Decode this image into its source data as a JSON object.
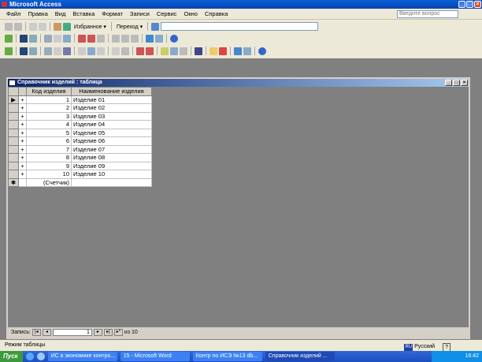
{
  "app": {
    "title": "Microsoft Access",
    "ask_placeholder": "Введите вопрос"
  },
  "menu": [
    "Файл",
    "Правка",
    "Вид",
    "Вставка",
    "Формат",
    "Записи",
    "Сервис",
    "Окно",
    "Справка"
  ],
  "web_toolbar": {
    "favorites": "Избранное ▾",
    "goto": "Переход ▾"
  },
  "child": {
    "title": "Справочник изделий : таблица",
    "columns": [
      "Код изделия",
      "Наименование изделия"
    ],
    "rows": [
      [
        "1",
        "Изделие 01"
      ],
      [
        "2",
        "Изделие 02"
      ],
      [
        "3",
        "Изделие 03"
      ],
      [
        "4",
        "Изделие 04"
      ],
      [
        "5",
        "Изделие 05"
      ],
      [
        "6",
        "Изделие 06"
      ],
      [
        "7",
        "Изделие 07"
      ],
      [
        "8",
        "Изделие 08"
      ],
      [
        "9",
        "Изделие 09"
      ],
      [
        "10",
        "Изделие 10"
      ]
    ],
    "new_row": "(Счетчик)",
    "nav": {
      "label": "Запись:",
      "current": "1",
      "of": "из 10"
    }
  },
  "status": {
    "mode": "Режим таблицы",
    "lang_code": "RU",
    "lang": "Русский"
  },
  "taskbar": {
    "start": "Пуск",
    "tasks": [
      "ИС в экономике контро...",
      "15 - Microsoft Word",
      "Контр по ИСЭ №13 db...",
      "Справочник изделий ..."
    ],
    "clock": "16:42"
  }
}
